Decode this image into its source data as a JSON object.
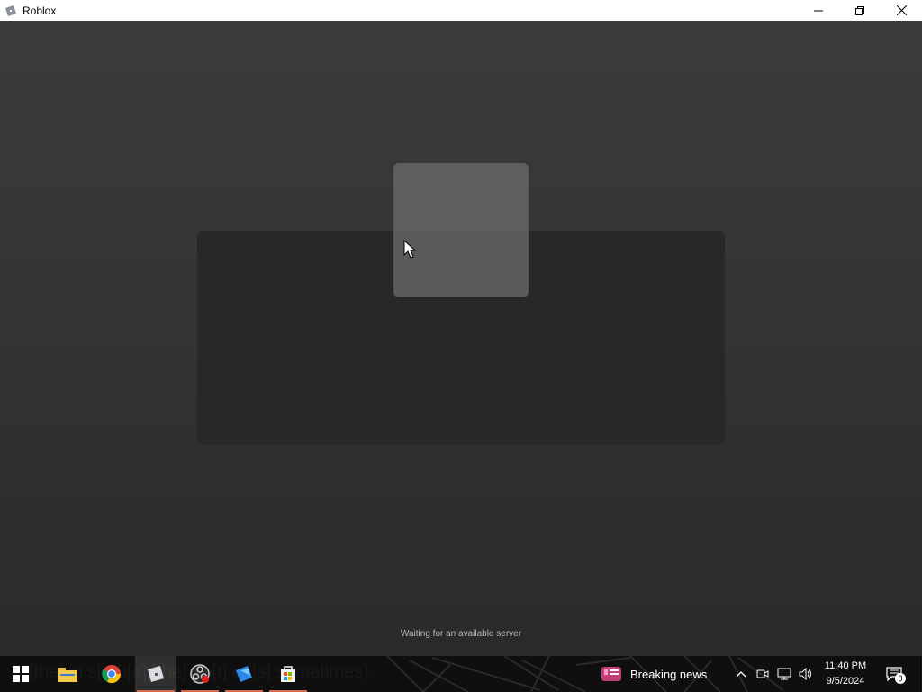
{
  "window": {
    "title": "Roblox",
    "controls": [
      "minimize-icon",
      "restore-icon",
      "close-icon"
    ]
  },
  "game": {
    "status_text": "Waiting for an available server"
  },
  "taskbar": {
    "overlay_caption": "[the] in s[n]h[e] [the] oo[t] ep[s] sometimes)",
    "apps": [
      {
        "name": "start-icon",
        "active": false
      },
      {
        "name": "file-explorer-icon",
        "active": false
      },
      {
        "name": "chrome-icon",
        "active": false
      },
      {
        "name": "roblox-player-icon",
        "active": true
      },
      {
        "name": "obs-icon",
        "active": false
      },
      {
        "name": "roblox-studio-icon",
        "active": false
      },
      {
        "name": "microsoft-store-icon",
        "active": false
      }
    ],
    "news_label": "Breaking news",
    "clock_time": "11:40 PM",
    "clock_date": "9/5/2024",
    "notification_count": "8"
  },
  "colors": {
    "taskbar_bg": "#0f0f0f",
    "run_indicator": "#d06a4a",
    "titlebar_bg": "#ffffff"
  }
}
